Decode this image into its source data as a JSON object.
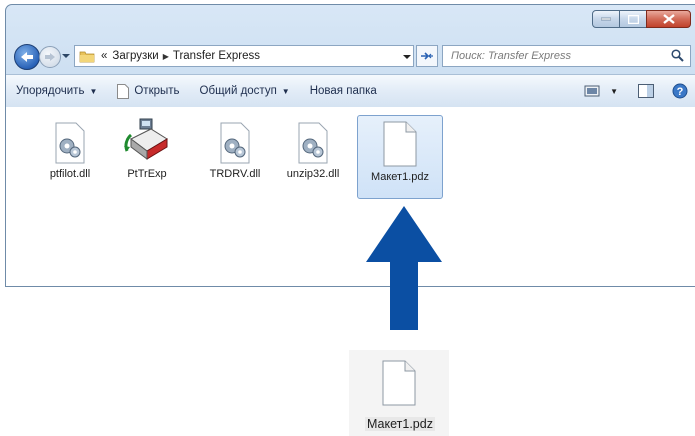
{
  "address": {
    "overflow": "«",
    "crumbs": [
      "Загрузки",
      "Transfer Express"
    ]
  },
  "search": {
    "placeholder": "Поиск: Transfer Express"
  },
  "toolbar": {
    "organize": "Упорядочить",
    "open": "Открыть",
    "share": "Общий доступ",
    "new_folder": "Новая папка"
  },
  "files": [
    {
      "name": "ptfilot.dll",
      "icon": "dll-gear-icon"
    },
    {
      "name": "PtTrExp",
      "icon": "app-printer-icon"
    },
    {
      "name": "TRDRV.dll",
      "icon": "dll-gear-icon"
    },
    {
      "name": "unzip32.dll",
      "icon": "dll-gear-icon"
    },
    {
      "name": "Макет1.pdz",
      "icon": "blank-file-icon",
      "selected": true
    }
  ],
  "drag": {
    "name": "Макет1.pdz",
    "icon": "blank-file-icon"
  },
  "colors": {
    "arrow": "#0b4fa3",
    "selection": "#cfe2f7"
  }
}
